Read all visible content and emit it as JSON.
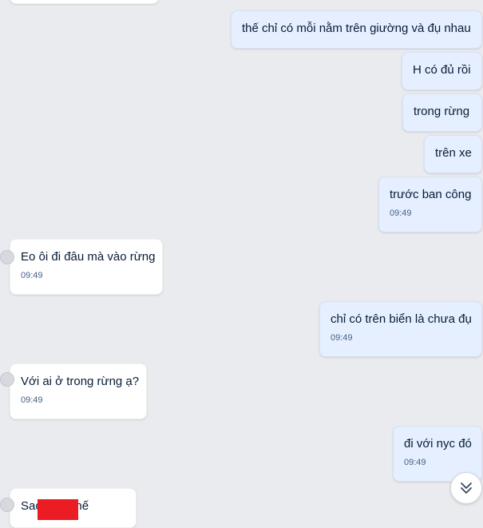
{
  "messages": [
    {
      "dir": "in",
      "text": "",
      "time": ""
    },
    {
      "dir": "out",
      "text": "thế chỉ có mỗi nằm trên giường và đụ nhau",
      "time": ""
    },
    {
      "dir": "out",
      "text": "H có đủ rồi",
      "time": ""
    },
    {
      "dir": "out",
      "text": "trong rừng",
      "time": ""
    },
    {
      "dir": "out",
      "text": "trên xe",
      "time": ""
    },
    {
      "dir": "out",
      "text": "trước ban công",
      "time": "09:49"
    },
    {
      "dir": "in",
      "text": "Eo ôi đi đâu mà vào rừng",
      "time": "09:49"
    },
    {
      "dir": "out",
      "text": "chỉ có trên biển là chưa đụ",
      "time": "09:49"
    },
    {
      "dir": "in",
      "text": "Với ai ở trong rừng ạ?",
      "time": "09:49"
    },
    {
      "dir": "out",
      "text": "đi với nyc đó",
      "time": "09:49"
    },
    {
      "dir": "in",
      "text": "Sao      dâm thế",
      "time": ""
    }
  ],
  "scroll_button": {
    "icon": "double-chevron-down-icon"
  },
  "colors": {
    "background": "#eaebef",
    "outgoing": "#e5efff",
    "incoming": "#ffffff",
    "redaction": "#ec1c24"
  }
}
